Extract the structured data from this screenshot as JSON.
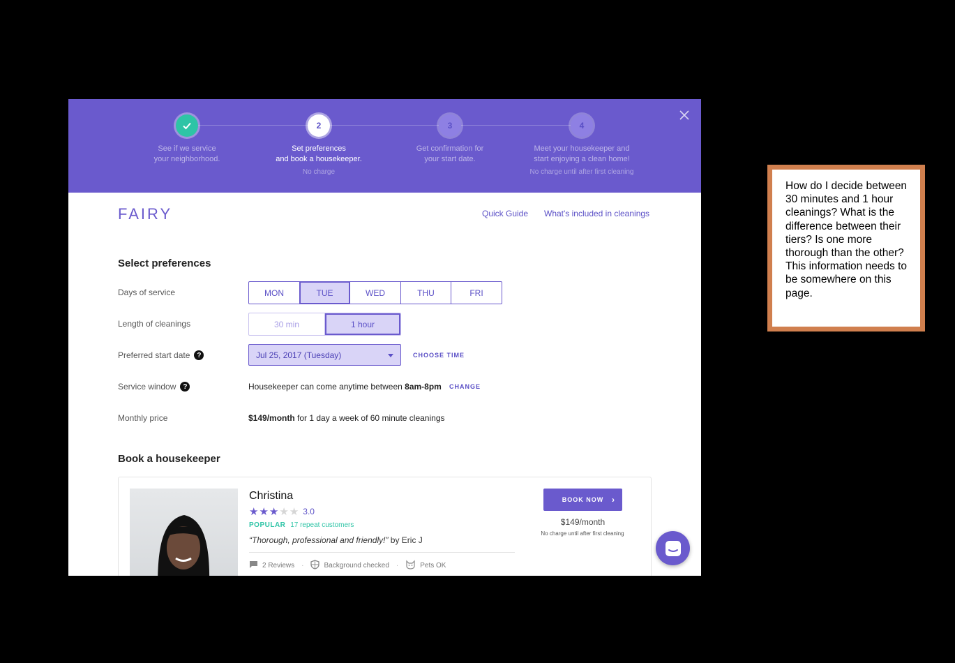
{
  "stepper": {
    "steps": [
      {
        "number": "",
        "label_line1": "See if we service",
        "label_line2": "your neighborhood.",
        "sub": "",
        "state": "done"
      },
      {
        "number": "2",
        "label_line1": "Set preferences",
        "label_line2": "and book a housekeeper.",
        "sub": "No charge",
        "state": "active"
      },
      {
        "number": "3",
        "label_line1": "Get confirmation for",
        "label_line2": "your start date.",
        "sub": "",
        "state": "pending"
      },
      {
        "number": "4",
        "label_line1": "Meet your housekeeper and",
        "label_line2": "start enjoying a clean home!",
        "sub": "No charge until after first cleaning",
        "state": "pending"
      }
    ]
  },
  "header": {
    "logo": "FAIRY",
    "quick_guide": "Quick Guide",
    "whats_included": "What's included in cleanings"
  },
  "preferences": {
    "title": "Select preferences",
    "days_label": "Days of service",
    "days": [
      "MON",
      "TUE",
      "WED",
      "THU",
      "FRI"
    ],
    "days_selected": "TUE",
    "length_label": "Length of cleanings",
    "lengths": [
      "30 min",
      "1 hour"
    ],
    "length_selected": "1 hour",
    "start_label": "Preferred start date",
    "start_value": "Jul 25, 2017 (Tuesday)",
    "choose_time": "CHOOSE TIME",
    "window_label": "Service window",
    "window_prefix": "Housekeeper can come anytime between",
    "window_value": "8am-8pm",
    "window_change": "CHANGE",
    "price_label": "Monthly price",
    "price_value": "$149/month",
    "price_suffix": "for 1 day a week of 60 minute cleanings"
  },
  "book": {
    "title": "Book a housekeeper",
    "housekeeper": {
      "name": "Christina",
      "rating": "3.0",
      "stars": 3,
      "popular": "POPULAR",
      "repeat": "17 repeat customers",
      "quote": "“Thorough, professional and friendly!”",
      "quote_by": "by Eric J",
      "reviews": "2 Reviews",
      "background": "Background checked",
      "pets": "Pets OK",
      "book_now": "BOOK NOW",
      "price": "$149/month",
      "no_charge": "No charge until after first cleaning"
    }
  },
  "note": {
    "text": "How do I decide between 30 minutes and 1 hour cleanings? What is the difference between their tiers? Is one more thorough than the other? This information needs to be somewhere on this page."
  },
  "colors": {
    "brand_purple": "#6a5acd",
    "teal": "#2ec4a6",
    "note_border": "#d07f4e"
  }
}
